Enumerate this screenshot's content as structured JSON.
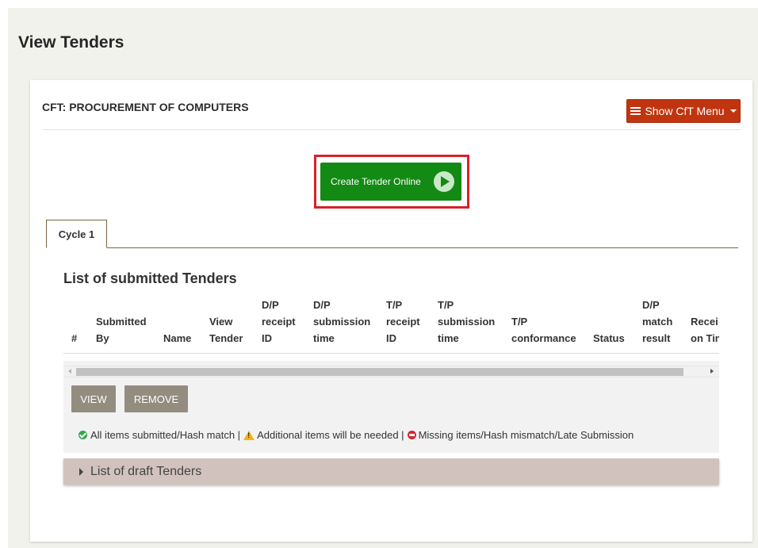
{
  "page": {
    "title": "View Tenders"
  },
  "cft": {
    "title": "CFT: PROCUREMENT OF COMPUTERS",
    "menu_button": {
      "label": "Show CfT Menu",
      "icon": "list-icon",
      "color": "#c0350f"
    }
  },
  "create_tender": {
    "label": "Create Tender Online",
    "icon": "play-icon",
    "color": "#138a14",
    "highlight_color": "#d7222a"
  },
  "tabs": [
    {
      "label": "Cycle 1",
      "active": true
    }
  ],
  "submitted": {
    "title": "List of submitted Tenders",
    "columns": [
      "#",
      "Submitted\nBy",
      "Name",
      "View\nTender",
      "D/P\nreceipt\nID",
      "D/P\nsubmission\ntime",
      "T/P\nreceipt\nID",
      "T/P\nsubmission\ntime",
      "T/P\nconformance",
      "Status",
      "D/P\nmatch\nresult",
      "Recei\non Tin"
    ],
    "rows": [],
    "actions": {
      "view": "VIEW",
      "remove": "REMOVE"
    },
    "legend": {
      "ok": "All items submitted/Hash match |",
      "warn": "Additional items will be needed |",
      "missing": "Missing items/Hash mismatch/Late Submission"
    }
  },
  "drafts": {
    "label": "List of draft Tenders"
  }
}
